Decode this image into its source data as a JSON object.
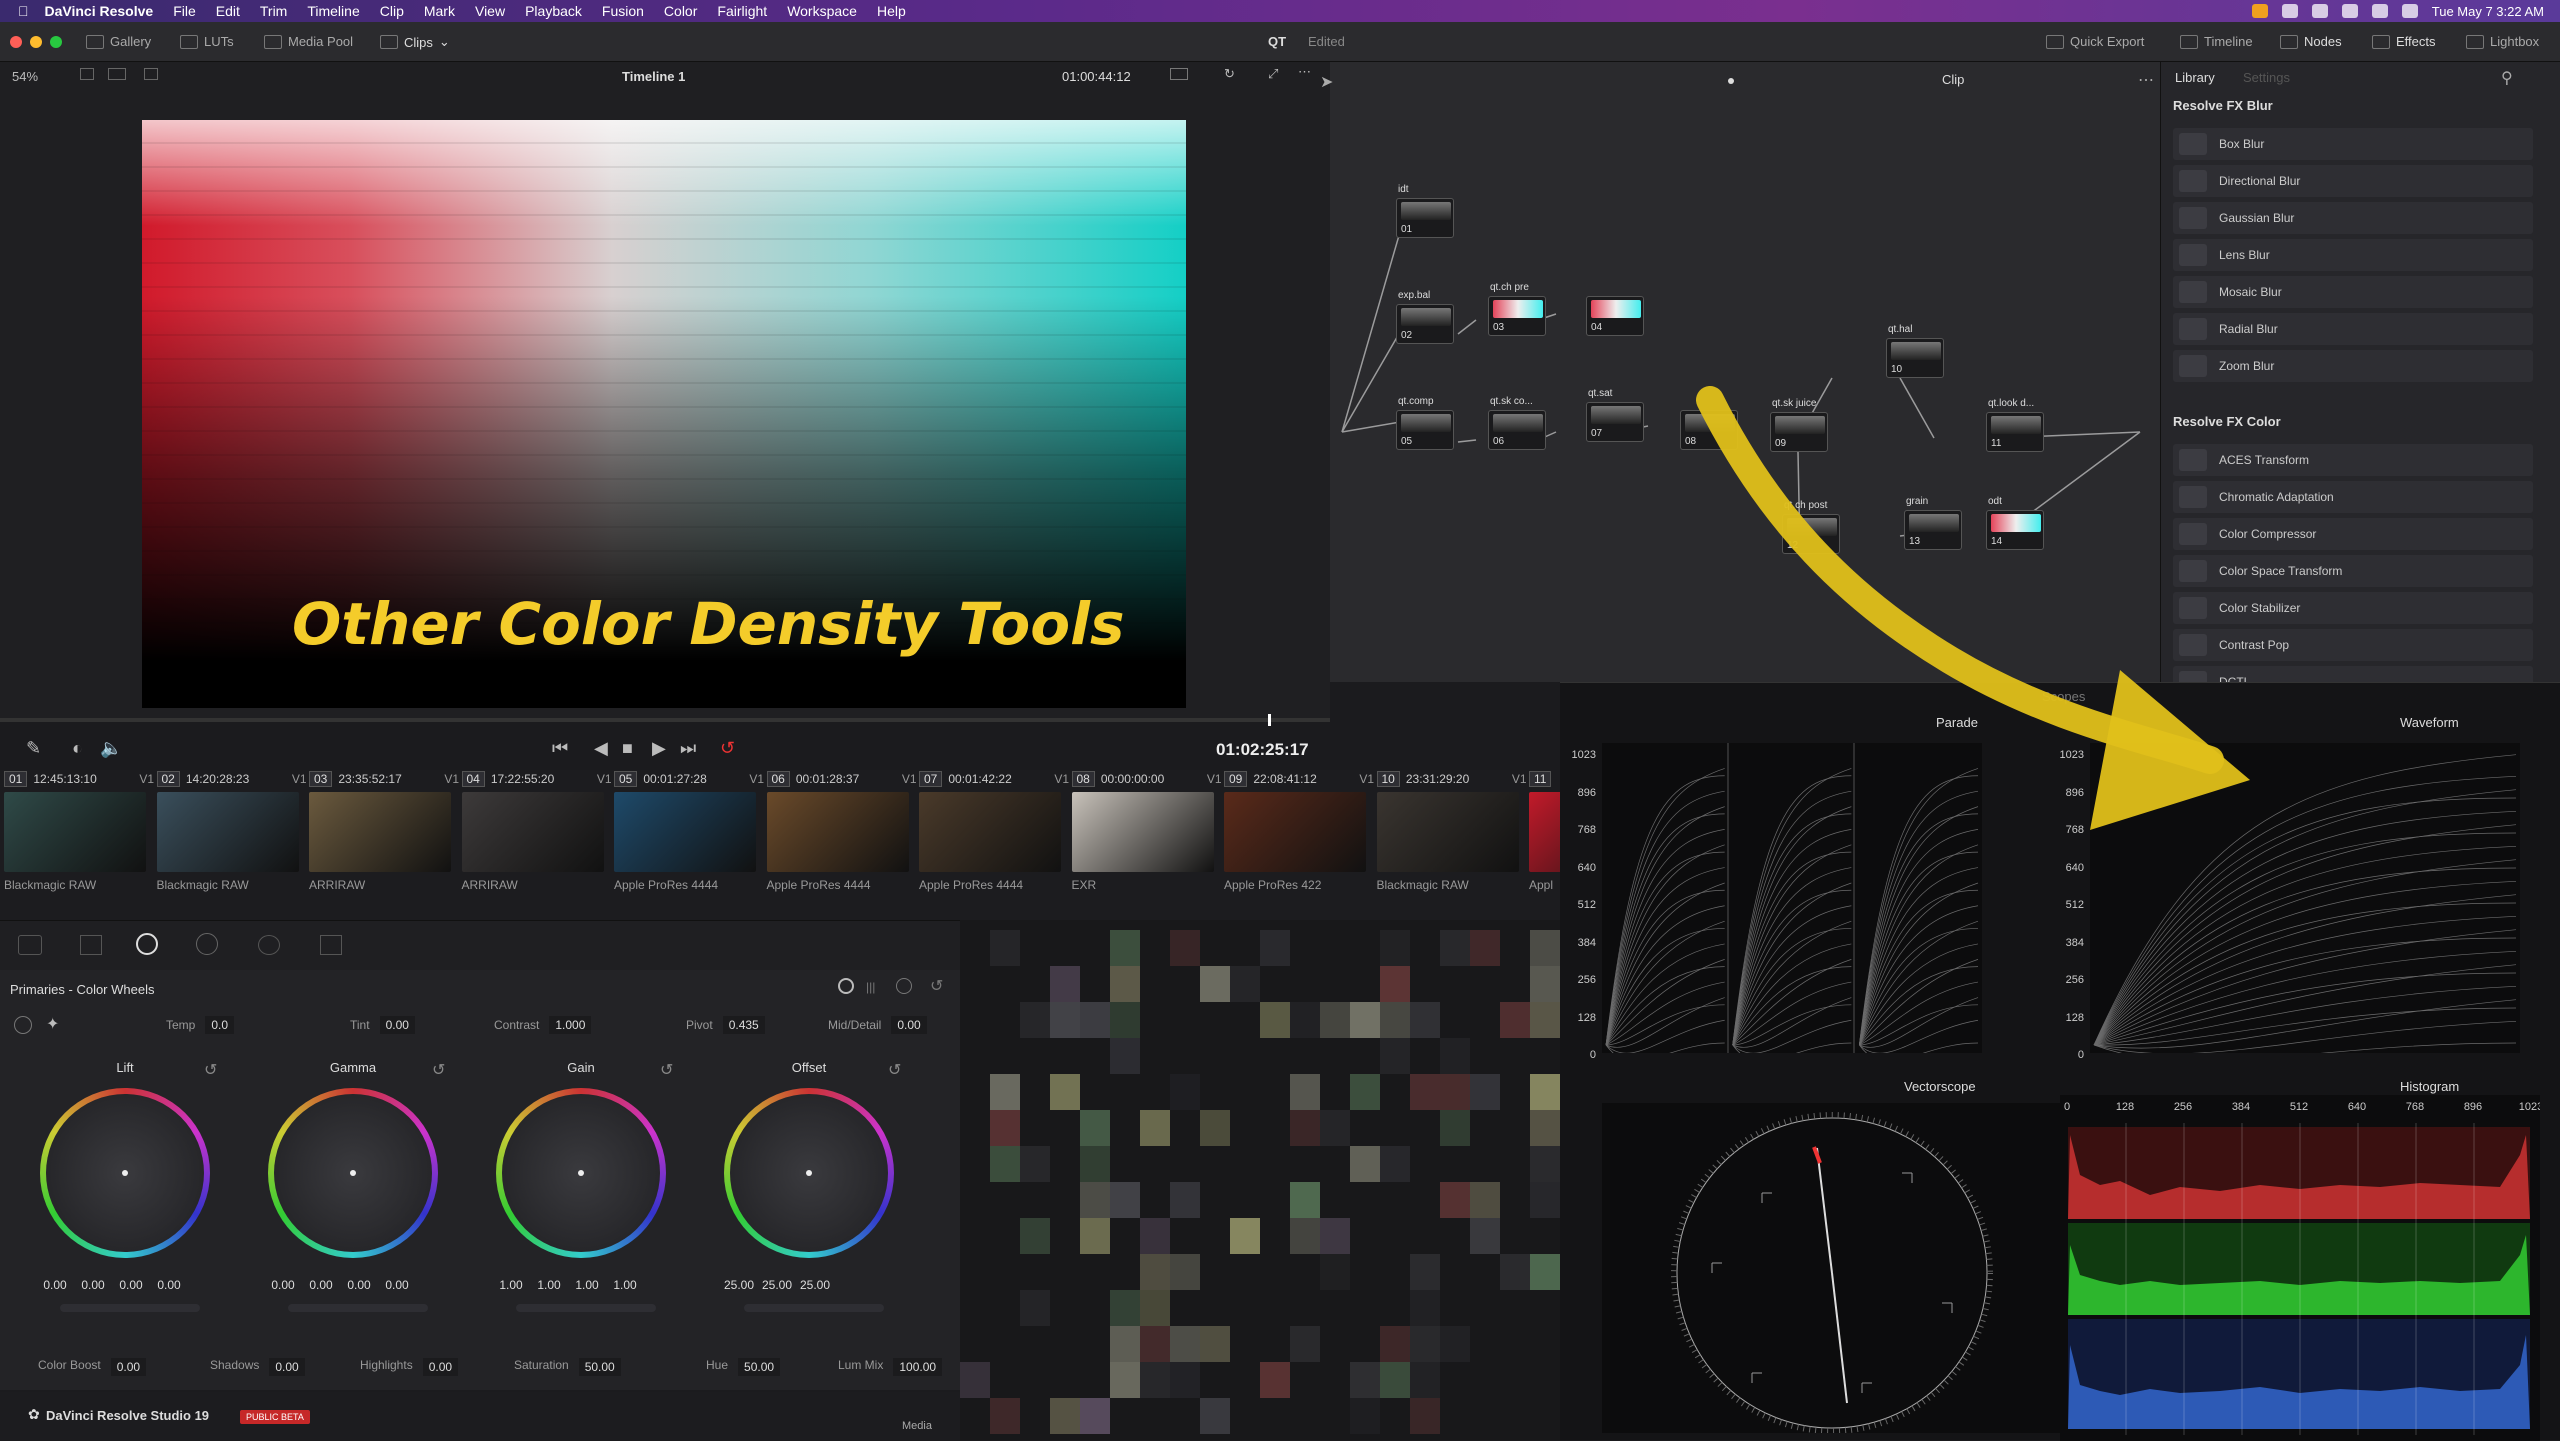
{
  "menubar": {
    "app": "DaVinci Resolve",
    "items": [
      "File",
      "Edit",
      "Trim",
      "Timeline",
      "Clip",
      "Mark",
      "View",
      "Playback",
      "Fusion",
      "Color",
      "Fairlight",
      "Workspace",
      "Help"
    ],
    "clock": "Tue May 7  3:22 AM"
  },
  "toolbar": {
    "gallery": "Gallery",
    "luts": "LUTs",
    "media_pool": "Media Pool",
    "clips": "Clips",
    "project": "QT",
    "status": "Edited",
    "quick_export": "Quick Export",
    "timeline": "Timeline",
    "nodes": "Nodes",
    "effects": "Effects",
    "lightbox": "Lightbox"
  },
  "viewer": {
    "zoom": "54%",
    "timeline_name": "Timeline 1",
    "timecode_top": "01:00:44:12",
    "clip_label": "Clip",
    "overlay_title": "Other Color Density Tools",
    "timecode": "01:02:25:17"
  },
  "clips": [
    {
      "num": "01",
      "tc": "12:45:13:10",
      "track": "V1",
      "codec": "Blackmagic RAW",
      "color": "#2f4a48"
    },
    {
      "num": "02",
      "tc": "14:20:28:23",
      "track": "V1",
      "codec": "Blackmagic RAW",
      "color": "#3a4f5c"
    },
    {
      "num": "03",
      "tc": "23:35:52:17",
      "track": "V1",
      "codec": "ARRIRAW",
      "color": "#6b5a3e"
    },
    {
      "num": "04",
      "tc": "17:22:55:20",
      "track": "V1",
      "codec": "ARRIRAW",
      "color": "#3d3a3a"
    },
    {
      "num": "05",
      "tc": "00:01:27:28",
      "track": "V1",
      "codec": "Apple ProRes 4444",
      "color": "#1e4a6a"
    },
    {
      "num": "06",
      "tc": "00:01:28:37",
      "track": "V1",
      "codec": "Apple ProRes 4444",
      "color": "#6a4a2a"
    },
    {
      "num": "07",
      "tc": "00:01:42:22",
      "track": "V1",
      "codec": "Apple ProRes 4444",
      "color": "#4a3a2a"
    },
    {
      "num": "08",
      "tc": "00:00:00:00",
      "track": "V1",
      "codec": "EXR",
      "color": "#c8c2ba"
    },
    {
      "num": "09",
      "tc": "22:08:41:12",
      "track": "V1",
      "codec": "Apple ProRes 422",
      "color": "#5a2a1a"
    },
    {
      "num": "10",
      "tc": "23:31:29:20",
      "track": "V1",
      "codec": "Blackmagic RAW",
      "color": "#3a3530"
    },
    {
      "num": "11",
      "tc": "",
      "track": "",
      "codec": "Appl",
      "color": "#c21a2a"
    }
  ],
  "primaries": {
    "title": "Primaries - Color Wheels",
    "temp_label": "Temp",
    "temp": "0.0",
    "tint_label": "Tint",
    "tint": "0.00",
    "contrast_label": "Contrast",
    "contrast": "1.000",
    "pivot_label": "Pivot",
    "pivot": "0.435",
    "middetail_label": "Mid/Detail",
    "middetail": "0.00",
    "wheels": [
      {
        "label": "Lift",
        "values": [
          "0.00",
          "0.00",
          "0.00",
          "0.00"
        ]
      },
      {
        "label": "Gamma",
        "values": [
          "0.00",
          "0.00",
          "0.00",
          "0.00"
        ]
      },
      {
        "label": "Gain",
        "values": [
          "1.00",
          "1.00",
          "1.00",
          "1.00"
        ]
      },
      {
        "label": "Offset",
        "values": [
          "25.00",
          "25.00",
          "25.00"
        ]
      }
    ],
    "colorboost_label": "Color Boost",
    "colorboost": "0.00",
    "shadows_label": "Shadows",
    "shadows": "0.00",
    "highlights_label": "Highlights",
    "highlights": "0.00",
    "saturation_label": "Saturation",
    "saturation": "50.00",
    "hue_label": "Hue",
    "hue": "50.00",
    "lummix_label": "Lum Mix",
    "lummix": "100.00"
  },
  "footer": {
    "product": "DaVinci Resolve Studio 19",
    "badge": "PUBLIC BETA",
    "media": "Media"
  },
  "nodes": [
    {
      "label": "idt",
      "num": "01"
    },
    {
      "label": "exp.bal",
      "num": "02"
    },
    {
      "label": "qt.ch pre",
      "num": "03"
    },
    {
      "label": "",
      "num": "04"
    },
    {
      "label": "qt.comp",
      "num": "05"
    },
    {
      "label": "qt.sk co...",
      "num": "06"
    },
    {
      "label": "qt.sat",
      "num": "07"
    },
    {
      "label": "",
      "num": "08"
    },
    {
      "label": "qt.sk juice",
      "num": "09"
    },
    {
      "label": "qt.hal",
      "num": "10"
    },
    {
      "label": "qt.look d...",
      "num": "11"
    },
    {
      "label": "qt.ch post",
      "num": "12"
    },
    {
      "label": "grain",
      "num": "13"
    },
    {
      "label": "odt",
      "num": "14"
    }
  ],
  "effects": {
    "tab_library": "Library",
    "tab_settings": "Settings",
    "blur_header": "Resolve FX Blur",
    "blur": [
      "Box Blur",
      "Directional Blur",
      "Gaussian Blur",
      "Lens Blur",
      "Mosaic Blur",
      "Radial Blur",
      "Zoom Blur"
    ],
    "color_header": "Resolve FX Color",
    "color": [
      "ACES Transform",
      "Chromatic Adaptation",
      "Color Compressor",
      "Color Space Transform",
      "Color Stabilizer",
      "Contrast Pop",
      "DCTL"
    ]
  },
  "scopes": {
    "title": "Scopes",
    "parade": "Parade",
    "waveform": "Waveform",
    "vectorscope": "Vectorscope",
    "histogram": "Histogram",
    "y_ticks": [
      "1023",
      "896",
      "768",
      "640",
      "512",
      "384",
      "256",
      "128",
      "0"
    ],
    "hist_ticks": [
      "0",
      "128",
      "256",
      "384",
      "512",
      "640",
      "768",
      "896",
      "1023"
    ]
  }
}
